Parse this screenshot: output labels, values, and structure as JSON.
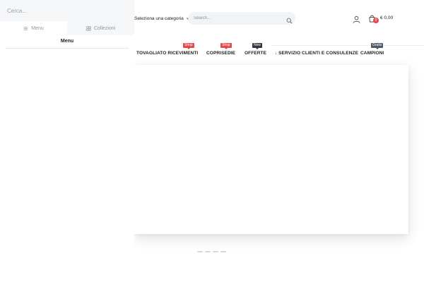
{
  "header": {
    "category_select": "Seleziona una categoria",
    "search_placeholder": "Search...",
    "cart_count": "0",
    "cart_total": "€ 0,00"
  },
  "nav": {
    "items": [
      {
        "label": "TOVAGLIATO RICEVIMENTI",
        "badge": "Shop",
        "badge_color": "#e3484d"
      },
      {
        "label": "COPRISEDIE",
        "badge": "Shop",
        "badge_color": "#e3484d"
      },
      {
        "label": "OFFERTE",
        "badge": "New",
        "badge_color": "#2f3640"
      },
      {
        "label": "SERVIZIO CLIENTI E CONSULENZE",
        "badge": "",
        "icon": "arrow-down-icon"
      },
      {
        "label": "CAMPIONI",
        "badge": "Gratis",
        "badge_color": "#4d5a66"
      }
    ]
  },
  "drawer": {
    "search_placeholder": "Cerca...",
    "tabs": [
      {
        "label": "Menu",
        "icon": "hamburger-icon",
        "active": true
      },
      {
        "label": "Collezioni",
        "icon": "grid-icon",
        "active": false
      }
    ],
    "heading": "Menu"
  },
  "slider": {
    "dot_count": 4
  },
  "colors": {
    "accent_red": "#e3484d",
    "badge_dark": "#2f3640",
    "search_bg": "#f1f3f6",
    "drawer_bg": "#f6f7f9"
  }
}
